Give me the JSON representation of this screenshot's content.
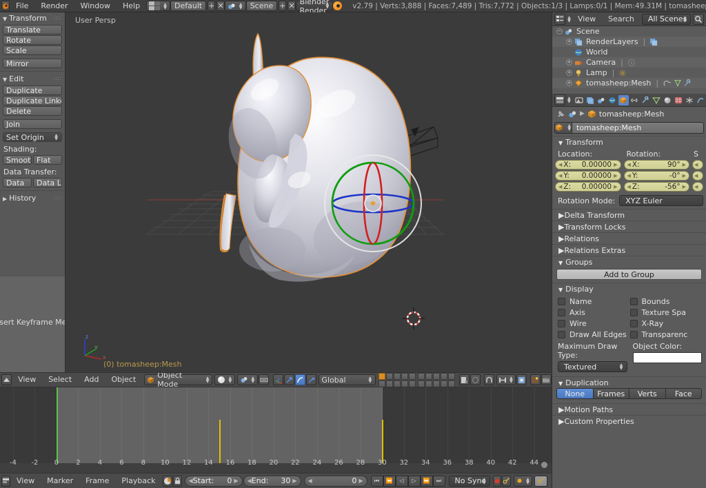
{
  "topbar": {
    "menus": [
      "File",
      "Render",
      "Window",
      "Help"
    ],
    "screen_layout": "Default",
    "scene_name": "Scene",
    "render_engine": "Blender Render",
    "stats": "v2.79 | Verts:3,888 | Faces:7,489 | Tris:7,772 | Objects:1/3 | Lamps:0/1 | Mem:49.31M | tomasheep:Mesh",
    "plus_glyph": "+",
    "x_glyph": "✕"
  },
  "toolshelf": {
    "transform": {
      "title": "Transform",
      "buttons": [
        "Translate",
        "Rotate",
        "Scale",
        "Mirror"
      ]
    },
    "edit": {
      "title": "Edit",
      "buttons": [
        "Duplicate",
        "Duplicate Linked",
        "Delete",
        "Join"
      ],
      "set_origin": "Set Origin",
      "shading_label": "Shading:",
      "shading_buttons": [
        "Smooth",
        "Flat"
      ],
      "data_transfer_label": "Data Transfer:",
      "data_transfer_buttons": [
        "Data",
        "Data Layo"
      ]
    },
    "history": {
      "title": "History"
    },
    "keyframe_menu_label": "Insert Keyframe Menu"
  },
  "viewport": {
    "perspective_label": "User Persp",
    "object_info": "(0) tomasheep:Mesh",
    "axis_labels": {
      "x": "x",
      "y": "y",
      "z": "z"
    },
    "colors": {
      "background": "#3b3b3b",
      "axis_x": "#8c3a3a",
      "axis_y": "#3a7a3a",
      "outline_selected": "#e08a30",
      "gizmo_x": "#d42b2b",
      "gizmo_y": "#1ea81e",
      "gizmo_z": "#2b46d4",
      "gizmo_view": "#ffffff"
    }
  },
  "viewheader": {
    "menus": [
      "View",
      "Select",
      "Add",
      "Object"
    ],
    "mode": "Object Mode",
    "transform_orientation": "Global"
  },
  "timeline": {
    "ruler_ticks": [
      -4,
      -2,
      0,
      2,
      4,
      6,
      8,
      10,
      12,
      14,
      16,
      18,
      20,
      22,
      24,
      26,
      28,
      30,
      32,
      34,
      36,
      38,
      40,
      42,
      44
    ],
    "frame_range": {
      "start": 0,
      "end": 30
    },
    "current_frame": 0,
    "keyframes": [
      0,
      15,
      30
    ],
    "menus": [
      "View",
      "Marker",
      "Frame",
      "Playback"
    ],
    "start_label": "Start:",
    "start_value": "0",
    "end_label": "End:",
    "end_value": "30",
    "current_frame_value": "0",
    "sync_mode": "No Sync",
    "transport_glyphs": [
      "⏮",
      "⏪",
      "◁",
      "▷",
      "⏩",
      "⏭"
    ]
  },
  "outliner": {
    "header": {
      "view": "View",
      "search": "Search",
      "filter": "All Scenes"
    },
    "rows": [
      {
        "label": "Scene",
        "indent": 0,
        "icon": "scene-icon",
        "expand": "−",
        "extra": ""
      },
      {
        "label": "RenderLayers",
        "indent": 1,
        "icon": "render-layers-icon",
        "expand": "+",
        "extra": "renderlayer"
      },
      {
        "label": "World",
        "indent": 1,
        "icon": "world-icon",
        "expand": "",
        "extra": ""
      },
      {
        "label": "Camera",
        "indent": 1,
        "icon": "camera-icon",
        "expand": "+",
        "extra": "cameradata"
      },
      {
        "label": "Lamp",
        "indent": 1,
        "icon": "lamp-icon",
        "expand": "+",
        "extra": "lampdata"
      },
      {
        "label": "tomasheep:Mesh",
        "indent": 1,
        "icon": "mesh-icon",
        "expand": "+",
        "extra": "modifier-mesh-wrench"
      }
    ]
  },
  "properties": {
    "breadcrumb_object": "tomasheep:Mesh",
    "id_name": "tomasheep:Mesh",
    "transform": {
      "title": "Transform",
      "location_label": "Location:",
      "rotation_label": "Rotation:",
      "scale_label": "S",
      "location": [
        {
          "axis": "X:",
          "value": "0.00000"
        },
        {
          "axis": "Y:",
          "value": "0.00000"
        },
        {
          "axis": "Z:",
          "value": "0.00000"
        }
      ],
      "rotation": [
        {
          "axis": "X:",
          "value": "90°"
        },
        {
          "axis": "Y:",
          "value": "-0°"
        },
        {
          "axis": "Z:",
          "value": "-56°"
        }
      ],
      "rotation_mode_label": "Rotation Mode:",
      "rotation_mode": "XYZ Euler"
    },
    "collapsed_panels": [
      "Delta Transform",
      "Transform Locks",
      "Relations",
      "Relations Extras"
    ],
    "groups": {
      "title": "Groups",
      "add_button": "Add to Group"
    },
    "display": {
      "title": "Display",
      "left_checks": [
        "Name",
        "Axis",
        "Wire",
        "Draw All Edges"
      ],
      "right_checks": [
        "Bounds",
        "Texture Spa",
        "X-Ray",
        "Transparenc"
      ],
      "max_draw_label": "Maximum Draw Type:",
      "max_draw_value": "Textured",
      "object_color_label": "Object Color:",
      "object_color": "#ffffff"
    },
    "duplication": {
      "title": "Duplication",
      "options": [
        "None",
        "Frames",
        "Verts",
        "Face"
      ],
      "selected": "None"
    },
    "bottom_panels": [
      "Motion Paths",
      "Custom Properties"
    ]
  }
}
